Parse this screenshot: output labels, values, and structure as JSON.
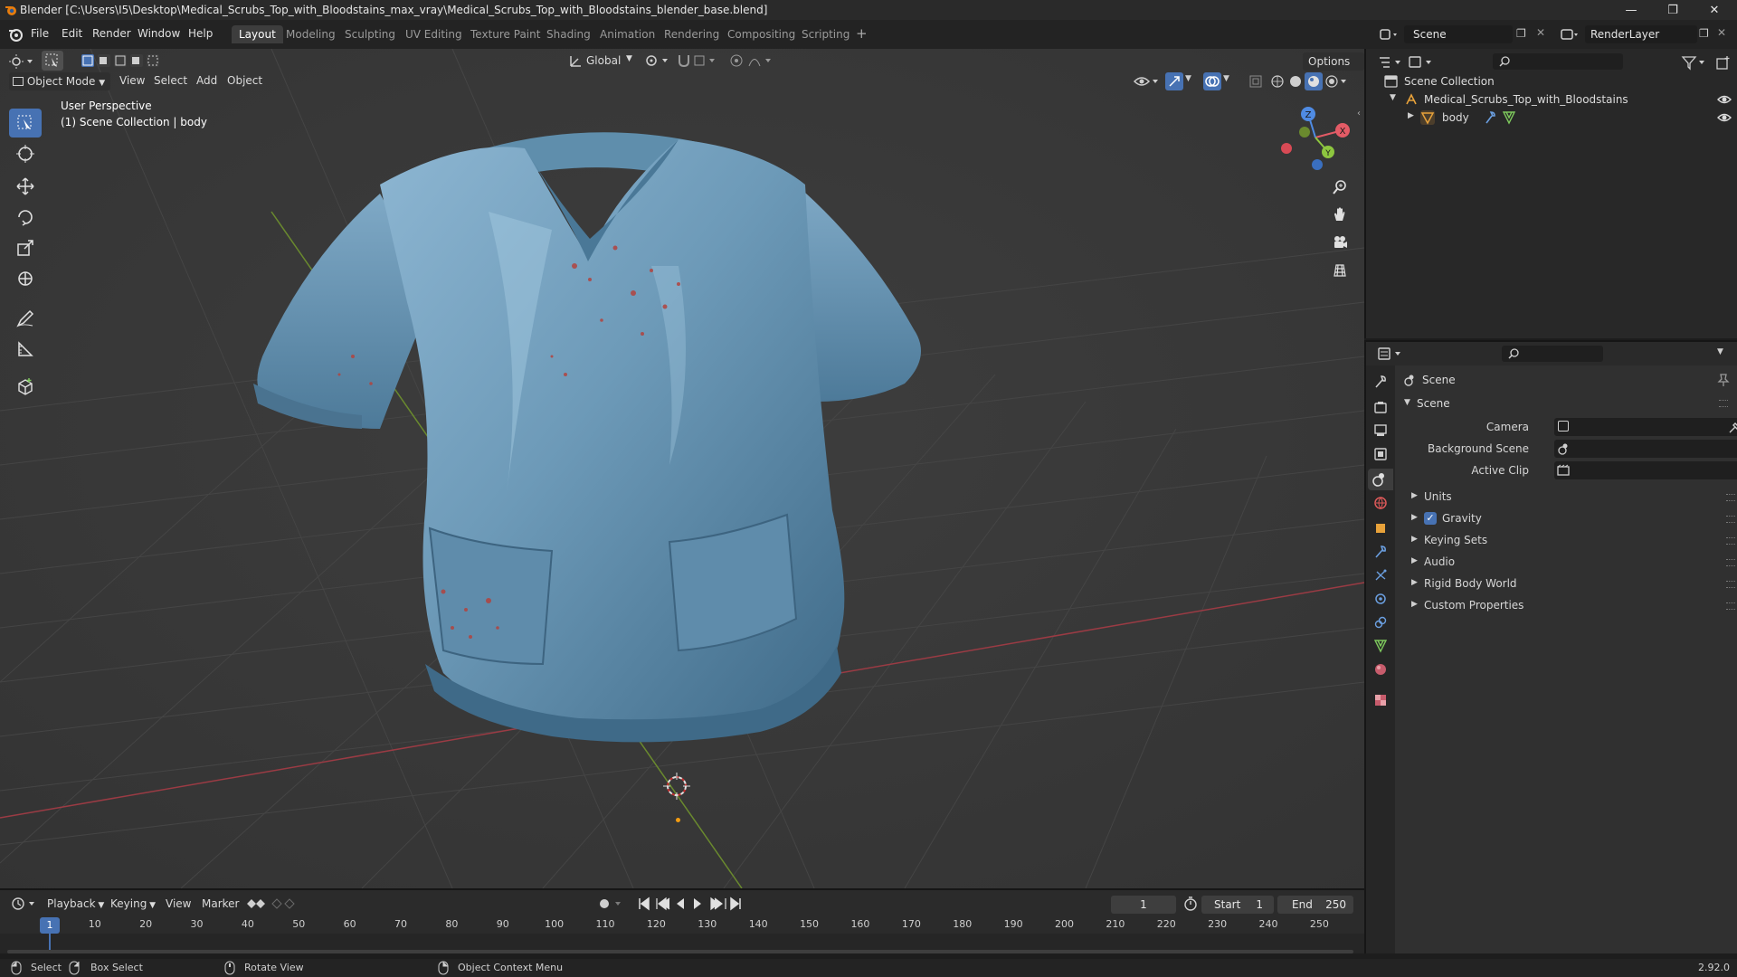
{
  "window": {
    "title": "Blender [C:\\Users\\I5\\Desktop\\Medical_Scrubs_Top_with_Bloodstains_max_vray\\Medical_Scrubs_Top_with_Bloodstains_blender_base.blend]"
  },
  "menu": {
    "items": [
      "File",
      "Edit",
      "Render",
      "Window",
      "Help"
    ]
  },
  "workspaces": {
    "tabs": [
      "Layout",
      "Modeling",
      "Sculpting",
      "UV Editing",
      "Texture Paint",
      "Shading",
      "Animation",
      "Rendering",
      "Compositing",
      "Scripting"
    ],
    "active": "Layout",
    "add_icon": "plus-icon"
  },
  "scene_selector": {
    "value": "Scene"
  },
  "viewlayer_selector": {
    "value": "RenderLayer"
  },
  "viewport": {
    "transform_orientation": "Global",
    "options_label": "Options",
    "mode_label": "Object Mode",
    "menus": [
      "View",
      "Select",
      "Add",
      "Object"
    ],
    "perspective_label": "User Perspective",
    "collection_label": "(1) Scene Collection | body",
    "gizmo_axes": [
      "X",
      "Y",
      "Z"
    ],
    "colors": {
      "background": "#393939",
      "grid": "#444444",
      "x_axis": "#9b3b44",
      "y_axis": "#6a8a2e",
      "shirt": "#6d9ab8",
      "accent": "#4772b3"
    }
  },
  "outliner": {
    "root": "Scene Collection",
    "items": [
      {
        "name": "Medical_Scrubs_Top_with_Bloodstains",
        "type": "collection"
      },
      {
        "name": "body",
        "type": "mesh"
      }
    ]
  },
  "properties": {
    "context_title": "Scene",
    "panel_title": "Scene",
    "fields": [
      {
        "label": "Camera"
      },
      {
        "label": "Background Scene"
      },
      {
        "label": "Active Clip"
      }
    ],
    "panels": [
      {
        "label": "Units",
        "checkbox": false
      },
      {
        "label": "Gravity",
        "checkbox": true
      },
      {
        "label": "Keying Sets",
        "checkbox": false
      },
      {
        "label": "Audio",
        "checkbox": false
      },
      {
        "label": "Rigid Body World",
        "checkbox": false
      },
      {
        "label": "Custom Properties",
        "checkbox": false
      }
    ]
  },
  "timeline": {
    "menus": [
      "Playback",
      "Keying",
      "View",
      "Marker"
    ],
    "current_frame": "1",
    "start_label": "Start",
    "start_value": "1",
    "end_label": "End",
    "end_value": "250",
    "ruler_ticks": [
      "1",
      "10",
      "20",
      "30",
      "40",
      "50",
      "60",
      "70",
      "80",
      "90",
      "100",
      "110",
      "120",
      "130",
      "140",
      "150",
      "160",
      "170",
      "180",
      "190",
      "200",
      "210",
      "220",
      "230",
      "240",
      "250"
    ]
  },
  "statusbar": {
    "select": "Select",
    "box_select": "Box Select",
    "rotate_view": "Rotate View",
    "context_menu": "Object Context Menu",
    "version": "2.92.0"
  }
}
